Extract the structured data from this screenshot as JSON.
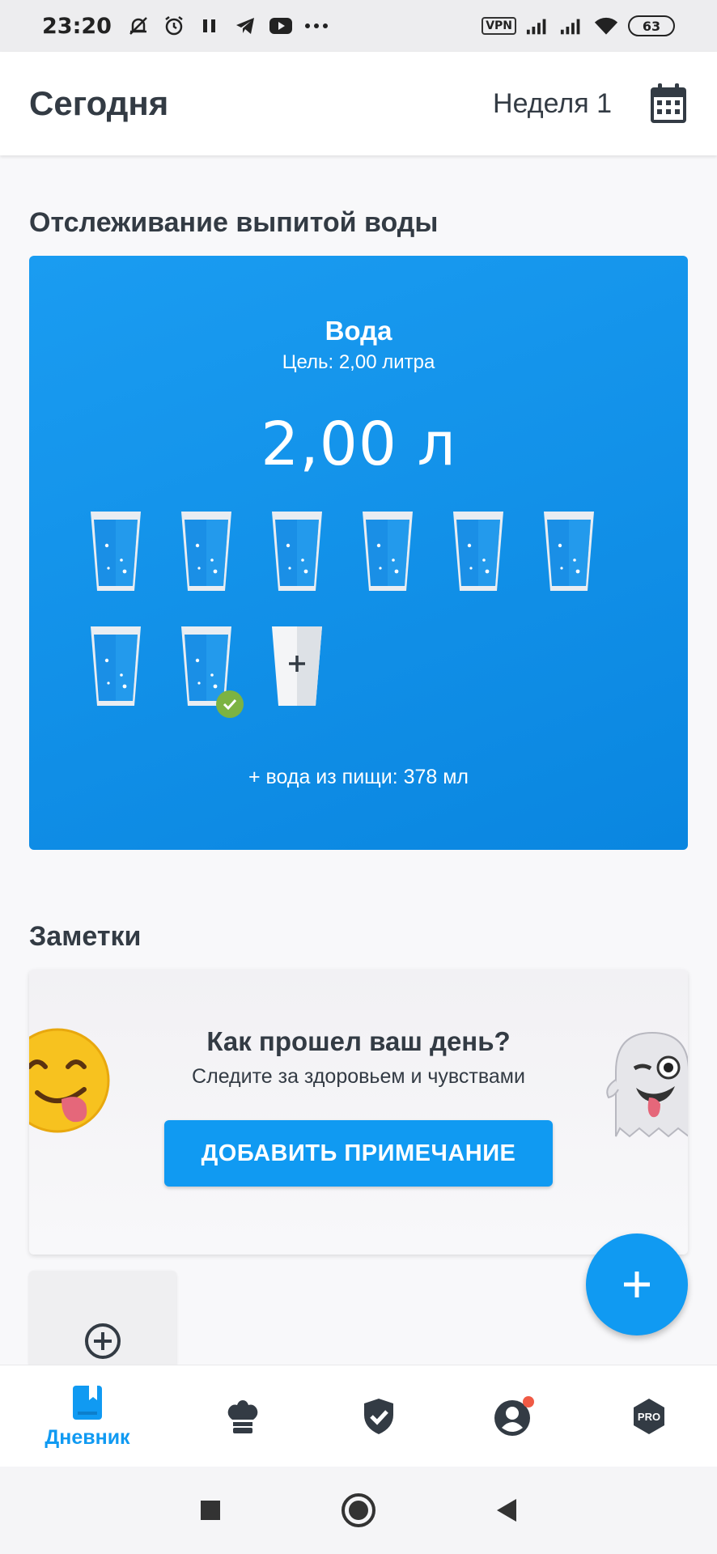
{
  "status_bar": {
    "time": "23:20",
    "vpn": "VPN",
    "battery": "63"
  },
  "header": {
    "title": "Сегодня",
    "week": "Неделя 1",
    "calendar_icon": "calendar-icon"
  },
  "water": {
    "section_title": "Отслеживание выпитой воды",
    "title": "Вода",
    "goal": "Цель: 2,00 литра",
    "amount": "2,00 л",
    "glasses_filled": 8,
    "add_glass_symbol": "+",
    "food_water": "+ вода из пищи: 378 мл",
    "accent": "#109af2",
    "check_color": "#7cb342"
  },
  "notes": {
    "section_title": "Заметки",
    "prompt_title": "Как прошел ваш день?",
    "prompt_sub": "Следите за здоровьем и чувствами",
    "add_button": "ДОБАВИТЬ ПРИМЕЧАНИЕ"
  },
  "bottom_nav": {
    "items": [
      {
        "icon": "diary-icon",
        "label": "Дневник",
        "active": true
      },
      {
        "icon": "chef-hat-icon"
      },
      {
        "icon": "shield-check-icon"
      },
      {
        "icon": "profile-icon",
        "badge": true
      },
      {
        "icon": "pro-icon",
        "text": "PRO"
      }
    ]
  }
}
